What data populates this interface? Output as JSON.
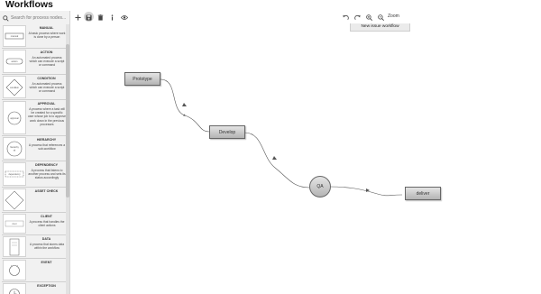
{
  "app": {
    "title": "Workflows"
  },
  "sidebar": {
    "search_placeholder": "Search for process nodes...",
    "items": [
      {
        "title": "MANUAL",
        "desc": "A basic process where work is done by a person",
        "thumb": "manual"
      },
      {
        "title": "ACTION",
        "desc": "An automated process which can execute a script or command",
        "thumb": "action"
      },
      {
        "title": "CONDITION",
        "desc": "An automated process which can execute a script or command",
        "thumb": "condition"
      },
      {
        "title": "APPROVAL",
        "desc": "A process where a task will be created for a specific user whose job is to approve work down in the previous processes",
        "thumb": "approval"
      },
      {
        "title": "HIERARCHY",
        "desc": "A process that references a sub-workflow",
        "thumb": "hierarchy"
      },
      {
        "title": "DEPENDENCY",
        "desc": "A process that listens to another process and sets its status accordingly",
        "thumb": "dependency"
      },
      {
        "title": "ASSET CHECK",
        "desc": "",
        "thumb": "asset-check"
      },
      {
        "title": "CLIENT",
        "desc": "A process that handles the client actions",
        "thumb": "client"
      },
      {
        "title": "DATA",
        "desc": "A process that stores data within the workflow",
        "thumb": "data"
      },
      {
        "title": "EVENT",
        "desc": "",
        "thumb": "event"
      },
      {
        "title": "EXCEPTION",
        "desc": "",
        "thumb": "exception"
      }
    ]
  },
  "toolbar": {
    "buttons": [
      {
        "name": "add-icon"
      },
      {
        "name": "save-icon"
      },
      {
        "name": "delete-icon"
      },
      {
        "name": "info-icon"
      },
      {
        "name": "view-icon"
      }
    ],
    "right_buttons": [
      {
        "name": "undo-icon"
      },
      {
        "name": "redo-icon"
      },
      {
        "name": "zoom-in-icon"
      },
      {
        "name": "zoom-out-icon"
      }
    ],
    "zoom_label": "Zoom"
  },
  "canvas": {
    "workflow_tab": "New issue workflow",
    "nodes": [
      {
        "id": "prototype",
        "label": "Prototype",
        "shape": "rect"
      },
      {
        "id": "develop",
        "label": "Develop",
        "shape": "rect"
      },
      {
        "id": "qa",
        "label": "QA",
        "shape": "circle"
      },
      {
        "id": "deliver",
        "label": "deliver",
        "shape": "rect"
      }
    ],
    "edges": [
      {
        "from": "prototype",
        "to": "develop"
      },
      {
        "from": "develop",
        "to": "qa"
      },
      {
        "from": "qa",
        "to": "deliver"
      }
    ],
    "colors": {
      "node_border": "#666666",
      "edge": "#555555"
    }
  }
}
